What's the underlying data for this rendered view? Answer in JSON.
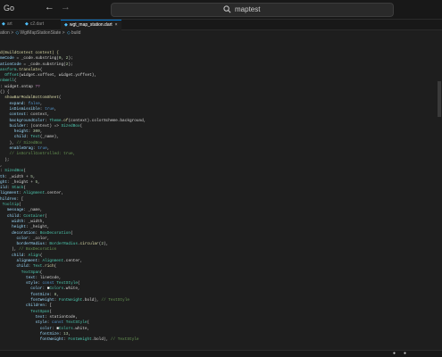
{
  "menu": {
    "go_label": "Go"
  },
  "nav": {
    "back_icon": "arrow-left-icon",
    "forward_icon": "arrow-right-icon"
  },
  "search": {
    "text": "maptest",
    "icon": "search-icon"
  },
  "tabs": [
    {
      "label": "art",
      "icon": "dart-icon"
    },
    {
      "label": "c2.dart",
      "icon": "dart-icon"
    },
    {
      "label": "wgt_map_station.dart",
      "icon": "dart-icon",
      "active": true
    }
  ],
  "breadcrumb": {
    "items": [
      "ation",
      "WgtMapStationState",
      "build"
    ],
    "separator": ">"
  },
  "code": {
    "lines": [
      [
        [
          "f",
          "d(BuildContext context) {"
        ]
      ],
      [
        [
          "v",
          "meCode"
        ],
        [
          "p",
          " = _code.substring("
        ],
        [
          "n",
          "0"
        ],
        [
          "p",
          ", "
        ],
        [
          "n",
          "2"
        ],
        [
          "p",
          ");"
        ]
      ],
      [
        [
          "v",
          "ationCode"
        ],
        [
          "p",
          " = _code.substring("
        ],
        [
          "n",
          "2"
        ],
        [
          "p",
          ");"
        ]
      ],
      [
        [
          "t",
          "ansform"
        ],
        [
          "p",
          "."
        ],
        [
          "f",
          "translate"
        ],
        [
          "p",
          "("
        ]
      ],
      [
        [
          "p",
          "  "
        ],
        [
          "t",
          "Offset"
        ],
        [
          "p",
          "(widget.xoffset, widget.yoffset),"
        ]
      ],
      [
        [
          "t",
          "nkWell"
        ],
        [
          "p",
          "("
        ]
      ],
      [
        [
          "p",
          ": widget.ontap "
        ],
        [
          "c",
          "??"
        ]
      ],
      [
        [
          "p",
          "() {"
        ]
      ],
      [
        [
          "f",
          "  showBarModalBottomSheet"
        ],
        [
          "p",
          "("
        ]
      ],
      [
        [
          "v",
          "    expand"
        ],
        [
          "p",
          ": "
        ],
        [
          "k",
          "false"
        ],
        [
          "p",
          ","
        ]
      ],
      [
        [
          "v",
          "    isDismissible"
        ],
        [
          "p",
          ": "
        ],
        [
          "k",
          "true"
        ],
        [
          "p",
          ","
        ]
      ],
      [
        [
          "v",
          "    context"
        ],
        [
          "p",
          ": context,"
        ]
      ],
      [
        [
          "v",
          "    backgroundColor"
        ],
        [
          "p",
          ": "
        ],
        [
          "t",
          "Theme"
        ],
        [
          "p",
          "."
        ],
        [
          "f",
          "of"
        ],
        [
          "p",
          "(context).colorScheme.background,"
        ]
      ],
      [
        [
          "v",
          "    builder"
        ],
        [
          "p",
          ": (context) => "
        ],
        [
          "t",
          "SizedBox"
        ],
        [
          "p",
          "("
        ]
      ],
      [
        [
          "v",
          "      height"
        ],
        [
          "p",
          ": "
        ],
        [
          "n",
          "300"
        ],
        [
          "p",
          ","
        ]
      ],
      [
        [
          "v",
          "      child"
        ],
        [
          "p",
          ": "
        ],
        [
          "t",
          "Text"
        ],
        [
          "p",
          "(_name),"
        ]
      ],
      [
        [
          "p",
          "    ), "
        ],
        [
          "cm",
          "// SizedBox"
        ]
      ],
      [
        [
          "v",
          "    enableDrag"
        ],
        [
          "p",
          ": "
        ],
        [
          "k",
          "true"
        ],
        [
          "p",
          ","
        ]
      ],
      [
        [
          "cm",
          "    // isScrollControlled: true,"
        ]
      ],
      [
        [
          "p",
          "  );"
        ]
      ],
      [
        [
          "p",
          ","
        ]
      ],
      [
        [
          "p",
          ": "
        ],
        [
          "t",
          "SizedBox"
        ],
        [
          "p",
          "("
        ]
      ],
      [
        [
          "v",
          "th"
        ],
        [
          "p",
          ": _width + "
        ],
        [
          "n",
          "5"
        ],
        [
          "p",
          ","
        ]
      ],
      [
        [
          "v",
          "ght"
        ],
        [
          "p",
          ": _height + "
        ],
        [
          "n",
          "5"
        ],
        [
          "p",
          ","
        ]
      ],
      [
        [
          "v",
          "ild"
        ],
        [
          "p",
          ": "
        ],
        [
          "t",
          "Stack"
        ],
        [
          "p",
          "("
        ]
      ],
      [
        [
          "v",
          "lignment"
        ],
        [
          "p",
          ": "
        ],
        [
          "t",
          "Alignment"
        ],
        [
          "p",
          ".center,"
        ]
      ],
      [
        [
          "v",
          "hildren"
        ],
        [
          "p",
          ": ["
        ]
      ],
      [
        [
          "p",
          " "
        ],
        [
          "t",
          "Tooltip"
        ],
        [
          "p",
          "("
        ]
      ],
      [
        [
          "v",
          "   message"
        ],
        [
          "p",
          ": _name,"
        ]
      ],
      [
        [
          "v",
          "   child"
        ],
        [
          "p",
          ": "
        ],
        [
          "t",
          "Container"
        ],
        [
          "p",
          "("
        ]
      ],
      [
        [
          "v",
          "     width"
        ],
        [
          "p",
          ": _width,"
        ]
      ],
      [
        [
          "v",
          "     height"
        ],
        [
          "p",
          ": _height,"
        ]
      ],
      [
        [
          "v",
          "     decoration"
        ],
        [
          "p",
          ": "
        ],
        [
          "t",
          "BoxDecoration"
        ],
        [
          "p",
          "("
        ]
      ],
      [
        [
          "v",
          "       color"
        ],
        [
          "p",
          ": _color,"
        ]
      ],
      [
        [
          "v",
          "       borderRadius"
        ],
        [
          "p",
          ": "
        ],
        [
          "t",
          "BorderRadius"
        ],
        [
          "p",
          "."
        ],
        [
          "f",
          "circular"
        ],
        [
          "p",
          "("
        ],
        [
          "n",
          "2"
        ],
        [
          "p",
          "),"
        ]
      ],
      [
        [
          "p",
          "     ), "
        ],
        [
          "cm",
          "// BoxDecoration"
        ]
      ],
      [
        [
          "v",
          "     child"
        ],
        [
          "p",
          ": "
        ],
        [
          "t",
          "Align"
        ],
        [
          "p",
          "("
        ]
      ],
      [
        [
          "v",
          "       alignment"
        ],
        [
          "p",
          ": "
        ],
        [
          "t",
          "Alignment"
        ],
        [
          "p",
          ".center,"
        ]
      ],
      [
        [
          "v",
          "       child"
        ],
        [
          "p",
          ": "
        ],
        [
          "t",
          "Text"
        ],
        [
          "p",
          "."
        ],
        [
          "f",
          "rich"
        ],
        [
          "p",
          "("
        ]
      ],
      [
        [
          "t",
          "         TextSpan"
        ],
        [
          "p",
          "("
        ]
      ],
      [
        [
          "v",
          "           text"
        ],
        [
          "p",
          ": lineCode,"
        ]
      ],
      [
        [
          "v",
          "           style"
        ],
        [
          "p",
          ": "
        ],
        [
          "k",
          "const "
        ],
        [
          "t",
          "TextStyle"
        ],
        [
          "p",
          "("
        ]
      ],
      [
        [
          "v",
          "             color"
        ],
        [
          "p",
          ": "
        ],
        [
          "w",
          "■"
        ],
        [
          "t",
          "Colors"
        ],
        [
          "p",
          ".white,"
        ]
      ],
      [
        [
          "v",
          "             fontSize"
        ],
        [
          "p",
          ": "
        ],
        [
          "n",
          "8"
        ],
        [
          "p",
          ","
        ]
      ],
      [
        [
          "v",
          "             fontWeight"
        ],
        [
          "p",
          ": "
        ],
        [
          "t",
          "FontWeight"
        ],
        [
          "p",
          ".bold), "
        ],
        [
          "cm",
          "// TextStyle"
        ]
      ],
      [
        [
          "v",
          "           children"
        ],
        [
          "p",
          ": ["
        ]
      ],
      [
        [
          "t",
          "             TextSpan"
        ],
        [
          "p",
          "("
        ]
      ],
      [
        [
          "v",
          "               text"
        ],
        [
          "p",
          ": stationCode,"
        ]
      ],
      [
        [
          "v",
          "               style"
        ],
        [
          "p",
          ": "
        ],
        [
          "k",
          "const "
        ],
        [
          "t",
          "TextStyle"
        ],
        [
          "p",
          "("
        ]
      ],
      [
        [
          "v",
          "                 color"
        ],
        [
          "p",
          ": "
        ],
        [
          "w",
          "■"
        ],
        [
          "t",
          "Colors"
        ],
        [
          "p",
          ".white,"
        ]
      ],
      [
        [
          "v",
          "                 fontSize"
        ],
        [
          "p",
          ": "
        ],
        [
          "n",
          "13"
        ],
        [
          "p",
          ","
        ]
      ],
      [
        [
          "v",
          "                 fontWeight"
        ],
        [
          "p",
          ": "
        ],
        [
          "t",
          "FontWeight"
        ],
        [
          "p",
          ".bold), "
        ],
        [
          "cm",
          "// TextStyle"
        ]
      ]
    ]
  }
}
